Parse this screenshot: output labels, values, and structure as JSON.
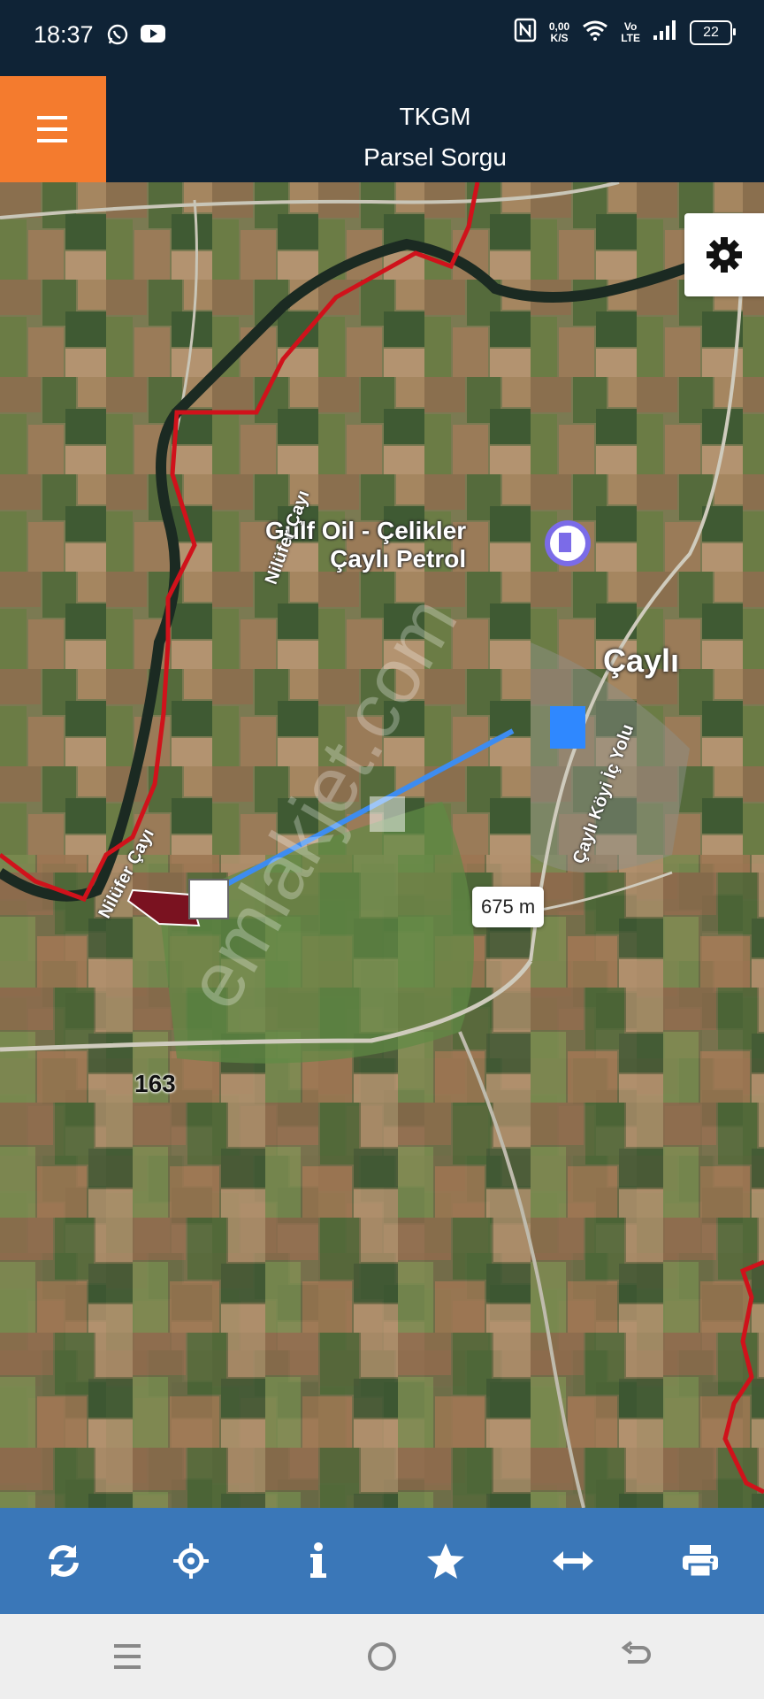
{
  "status_bar": {
    "time": "18:37",
    "net_speed_value": "0,00",
    "net_speed_unit": "K/S",
    "volte_top": "Vo",
    "volte_bottom": "LTE",
    "battery": "22",
    "icons": [
      "whatsapp-icon",
      "youtube-icon",
      "nfc-icon",
      "wifi-icon",
      "signal-icon"
    ]
  },
  "app_bar": {
    "title": "TKGM",
    "subtitle": "Parsel Sorgu",
    "accent_color": "#f47b2e",
    "bar_color": "#0f2336"
  },
  "map": {
    "poi_line1": "Gulf Oil - Çelikler",
    "poi_line2": "Çaylı Petrol",
    "place_name": "Çaylı",
    "river_label_1": "Nilüfer Çayı",
    "river_label_2": "Nilüfer Çayı",
    "road_label": "Çaylı Köyi İç Yolu",
    "distance": "675 m",
    "parcel_number": "163",
    "watermark": "emlakjet.com",
    "boundary_color": "#d0121b",
    "measure_color": "#3d8cf0"
  },
  "toolbar": {
    "color": "#3a77b8",
    "buttons": [
      "refresh-icon",
      "locate-icon",
      "info-icon",
      "star-icon",
      "measure-icon",
      "print-icon"
    ]
  },
  "nav_bar": {
    "buttons": [
      "recents-icon",
      "home-icon",
      "back-icon"
    ]
  }
}
